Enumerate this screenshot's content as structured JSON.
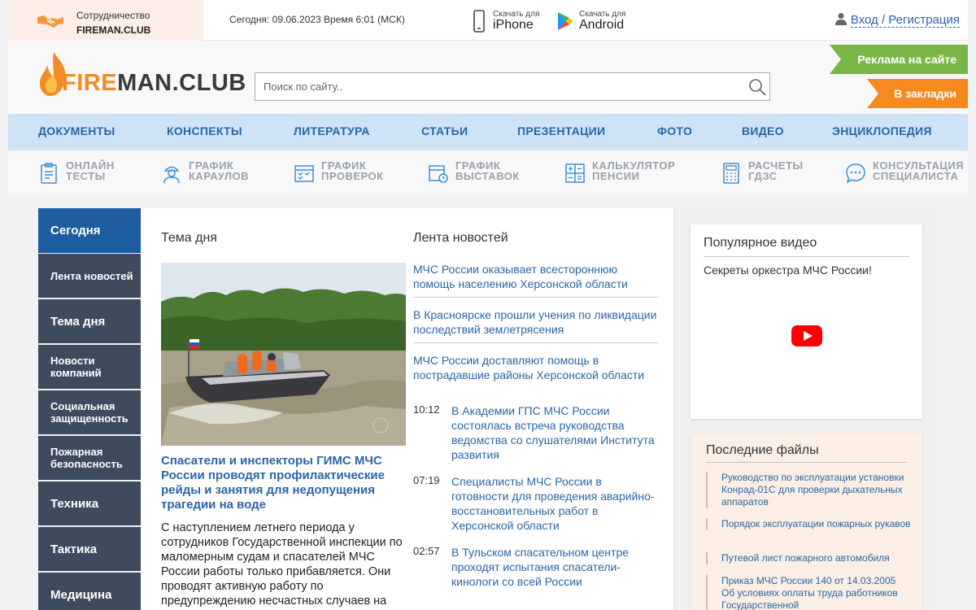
{
  "topbar": {
    "partner_line1": "Сотрудничество",
    "partner_line2": "FIREMAN.CLUB",
    "datetime": "Сегодня: 09.06.2023 Время 6:01 (МСК)",
    "iphone": {
      "small": "Скачать для",
      "big": "iPhone",
      "icon": "phone-icon"
    },
    "android": {
      "small": "Скачать для",
      "big": "Android",
      "icon": "play-store-icon"
    },
    "login": "Вход / Регистрация"
  },
  "header": {
    "logo_fire": "FIRE",
    "logo_rest": "MAN.CLUB",
    "search_placeholder": "Поиск по сайту..",
    "ad_button": "Реклама на сайте",
    "bookmark_button": "В закладки"
  },
  "colors": {
    "accent": "#2a66a5",
    "sidebar": "#3d4b5c",
    "sidebar_active": "#1e5da0",
    "green": "#7ab647",
    "orange": "#f68a1f"
  },
  "mainnav": [
    "ДОКУМЕНТЫ",
    "КОНСПЕКТЫ",
    "ЛИТЕРАТУРА",
    "СТАТЬИ",
    "ПРЕЗЕНТАЦИИ",
    "ФОТО",
    "ВИДЕО",
    "ЭНЦИКЛОПЕДИЯ"
  ],
  "services": [
    {
      "l1": "ОНЛАЙН",
      "l2": "ТЕСТЫ",
      "icon": "clipboard-icon"
    },
    {
      "l1": "ГРАФИК",
      "l2": "КАРАУЛОВ",
      "icon": "firefighter-icon"
    },
    {
      "l1": "ГРАФИК",
      "l2": "ПРОВЕРОК",
      "icon": "calendar-check-icon"
    },
    {
      "l1": "ГРАФИК",
      "l2": "ВЫСТАВОК",
      "icon": "calendar-clock-icon"
    },
    {
      "l1": "КАЛЬКУЛЯТОР",
      "l2": "ПЕНСИИ",
      "icon": "calculator-icon"
    },
    {
      "l1": "РАСЧЕТЫ",
      "l2": "ГДЗС",
      "icon": "calculator-grid-icon"
    },
    {
      "l1": "КОНСУЛЬТАЦИЯ",
      "l2": "СПЕЦИАЛИСТА",
      "icon": "chat-icon"
    }
  ],
  "sidebar": [
    "Сегодня",
    "Лента новостей",
    "Тема дня",
    "Новости компаний",
    "Социальная защищенность",
    "Пожарная безопасность",
    "Техника",
    "Тактика",
    "Медицина"
  ],
  "tema": {
    "heading": "Тема дня",
    "title": "Спасатели и инспекторы ГИМС МЧС России проводят профилактические рейды и занятия для недопущения трагедии на воде",
    "text": "С наступлением летнего периода у сотрудников Государственной инспекции по маломерным судам и спасателей МЧС России работы только прибавляется. Они проводят активную работу по предупреждению несчастных случаев на"
  },
  "lenta": {
    "heading": "Лента новостей",
    "top_items": [
      "МЧС России оказывает всестороннюю помощь населению Херсонской области",
      "В Красноярске прошли учения по ликвидации последствий землетрясения",
      "МЧС России доставляют помощь в пострадавшие районы Херсонской области"
    ],
    "timed_items": [
      {
        "time": "10:12",
        "text": "В Академии ГПС МЧС России состоялась встреча руководства ведомства со слушателями Института развития"
      },
      {
        "time": "07:19",
        "text": "Специалисты МЧС России в готовности для проведения аварийно-восстановительных работ в Херсонской области"
      },
      {
        "time": "02:57",
        "text": "В Тульском спасательном центре проходят испытания спасатели-кинологи со всей России"
      }
    ]
  },
  "video": {
    "heading": "Популярное видео",
    "title": "Секреты оркестра МЧС России!"
  },
  "files": {
    "heading": "Последние файлы",
    "items": [
      "Руководство по эксплуатации установки Конрад-01С для проверки дыхательных аппаратов",
      "Порядок эксплуатации пожарных рукавов",
      "Путевой лист пожарного автомобиля",
      "Приказ МЧС России 140 от 14.03.2005 Об условиях оплаты труда работников Государственной"
    ]
  }
}
